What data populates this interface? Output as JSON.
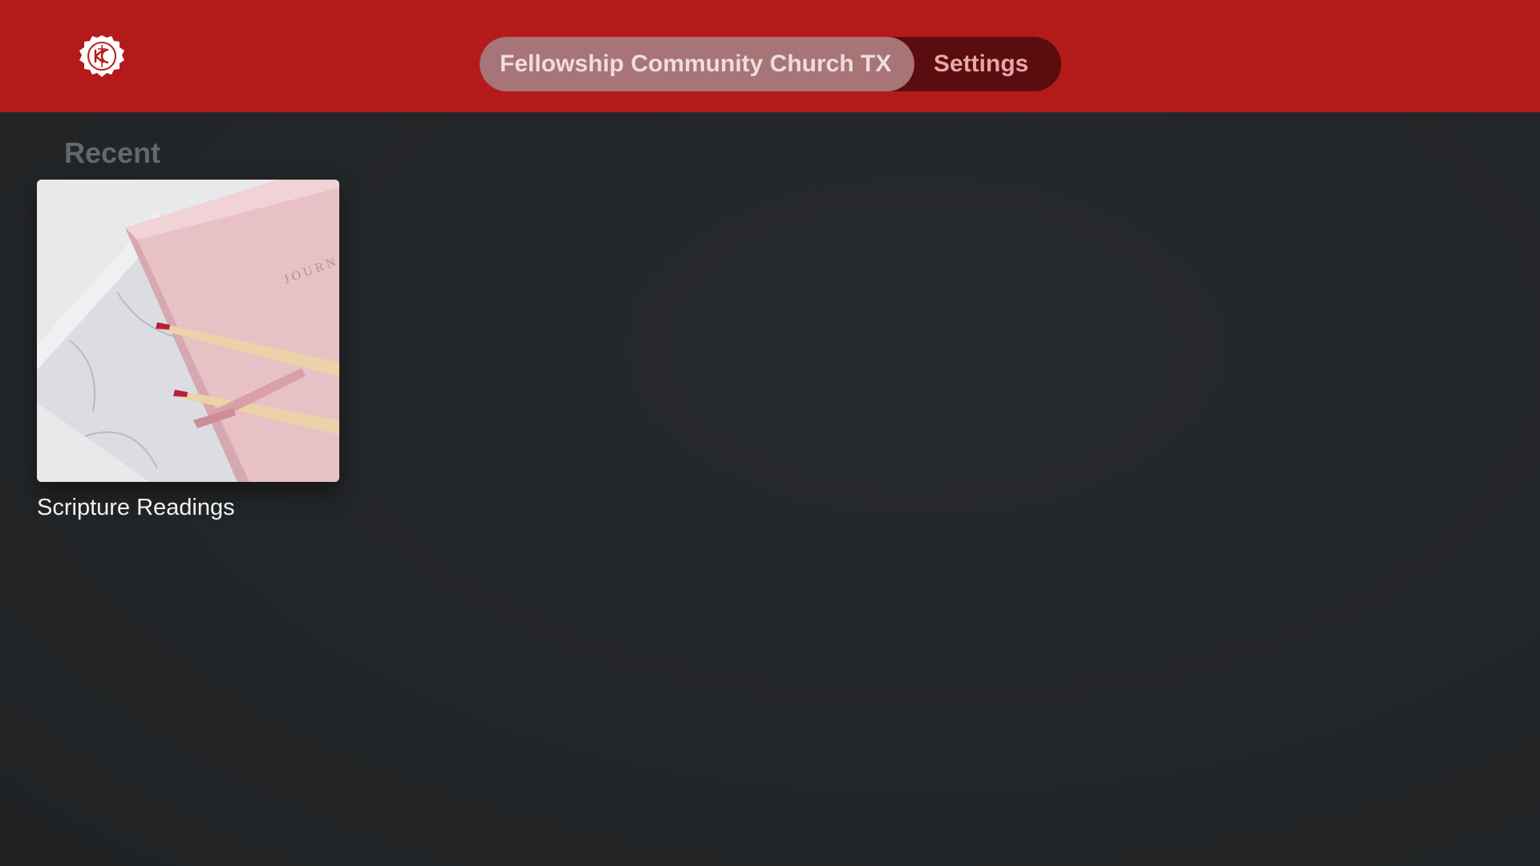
{
  "header": {
    "logo_icon": "church-seal-logo-icon",
    "tabs": [
      {
        "label": "Fellowship Community Church TX",
        "active": true
      },
      {
        "label": "Settings",
        "active": false
      }
    ]
  },
  "main": {
    "section_title": "Recent",
    "items": [
      {
        "title": "Scripture Readings",
        "thumbnail": "journal-and-pencils-image"
      }
    ]
  },
  "colors": {
    "header_red": "#b51a1b",
    "tab_pill": "#5b0c0e",
    "tab_active": "#a77477",
    "background": "#232629"
  }
}
